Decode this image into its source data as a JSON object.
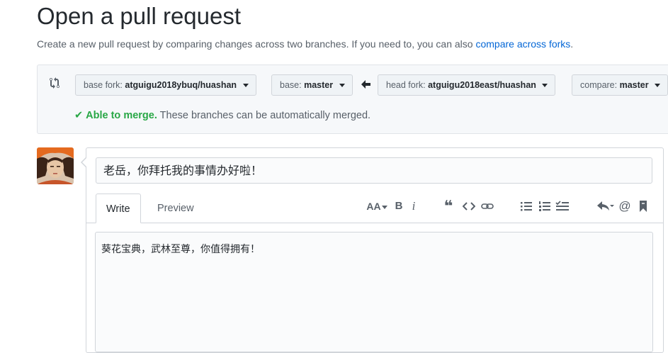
{
  "page": {
    "title": "Open a pull request",
    "subtitle_text": "Create a new pull request by comparing changes across two branches. If you need to, you can also ",
    "subtitle_link": "compare across forks",
    "subtitle_end": "."
  },
  "range": {
    "base_fork_label": "base fork:",
    "base_fork_value": "atguigu2018ybuq/huashan",
    "base_label": "base:",
    "base_value": "master",
    "head_fork_label": "head fork:",
    "head_fork_value": "atguigu2018east/huashan",
    "compare_label": "compare:",
    "compare_value": "master",
    "merge_ok": "Able to merge.",
    "merge_text": " These branches can be automatically merged."
  },
  "comment": {
    "title_value": "老岳，你拜托我的事情办好啦！",
    "tabs": [
      {
        "label": "Write",
        "active": true
      },
      {
        "label": "Preview",
        "active": false
      }
    ],
    "body_value": "葵花宝典，武林至尊，你值得拥有！",
    "toolbar": {
      "header_text": "AA",
      "bold_text": "B",
      "italic_text": "i",
      "quote_text": "❝"
    }
  },
  "colors": {
    "link": "#0366d6",
    "success": "#28a745",
    "border": "#d1d5da",
    "bg_gray": "#f6f8fa"
  }
}
